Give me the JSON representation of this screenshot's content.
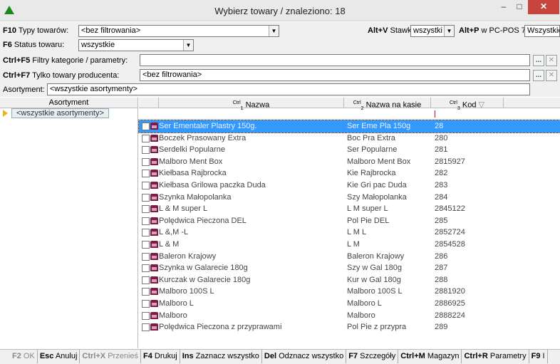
{
  "window": {
    "title": "Wybierz towary / znaleziono: 18",
    "minimize": "–",
    "maximize": "□",
    "close": "✕"
  },
  "filters": {
    "typy_key": "F10",
    "typy_label": "Typy towarów:",
    "typy_value": "<bez filtrowania>",
    "status_key": "F6",
    "status_label": "Status towaru:",
    "status_value": "wszystkie",
    "stawka_key": "Alt+V",
    "stawka_label": "Stawka:",
    "stawka_value": "wszystki",
    "pcpos_key": "Alt+P",
    "pcpos_label": "w PC-POS 7:",
    "pcpos_value": "Wszystkie",
    "kategorie_key": "Ctrl+F5",
    "kategorie_label": "Filtry kategorie / parametry:",
    "kategorie_value": "",
    "producent_key": "Ctrl+F7",
    "producent_label": "Tylko towary producenta:",
    "producent_value": "<bez filtrowania>",
    "asortyment_label": "Asortyment:",
    "asortyment_value": "<wszystkie asortymenty>",
    "dots": "...",
    "clear": "✕"
  },
  "left_pane": {
    "header": "Asortyment",
    "items": [
      "<wszystkie asortymenty>"
    ]
  },
  "grid": {
    "columns": [
      {
        "ctrl": "Ctrl",
        "num": "1",
        "label": "Nazwa"
      },
      {
        "ctrl": "Ctrl",
        "num": "2",
        "label": "Nazwa na kasie"
      },
      {
        "ctrl": "Ctrl",
        "num": "3",
        "label": "Kod",
        "sort": "▽"
      }
    ],
    "rows": [
      {
        "name": "Ser Ementaler Plastry 150g.",
        "kasa": "Ser Eme Pla 150g",
        "kod": "28",
        "selected": true
      },
      {
        "name": "Boczek Prasowany Extra",
        "kasa": "Boc Pra Extra",
        "kod": "280"
      },
      {
        "name": "Serdelki Popularne",
        "kasa": "Ser Popularne",
        "kod": "281"
      },
      {
        "name": "Malboro Ment Box",
        "kasa": "Malboro Ment Box",
        "kod": "2815927"
      },
      {
        "name": "Kiełbasa Rajbrocka",
        "kasa": "Kie Rajbrocka",
        "kod": "282"
      },
      {
        "name": "Kiełbasa Grilowa paczka Duda",
        "kasa": "Kie Gri pac Duda",
        "kod": "283"
      },
      {
        "name": "Szynka Małopolanka",
        "kasa": "Szy Małopolanka",
        "kod": "284"
      },
      {
        "name": "L & M super L",
        "kasa": "L M super L",
        "kod": "2845122"
      },
      {
        "name": "Polędwica Pieczona DEL",
        "kasa": "Pol Pie DEL",
        "kod": "285"
      },
      {
        "name": "L &,M -L",
        "kasa": "L M L",
        "kod": "2852724"
      },
      {
        "name": "L & M",
        "kasa": "L M",
        "kod": "2854528"
      },
      {
        "name": "Baleron Krajowy",
        "kasa": "Baleron Krajowy",
        "kod": "286"
      },
      {
        "name": "Szynka w Galarecie 180g",
        "kasa": "Szy w Gal 180g",
        "kod": "287"
      },
      {
        "name": "Kurczak w Galarecie 180g",
        "kasa": "Kur w Gal 180g",
        "kod": "288"
      },
      {
        "name": "Malboro 100S L",
        "kasa": "Malboro 100S L",
        "kod": "2881920"
      },
      {
        "name": "Malboro L",
        "kasa": "Malboro L",
        "kod": "2886925"
      },
      {
        "name": "Malboro",
        "kasa": "Malboro",
        "kod": "2888224"
      },
      {
        "name": "Polędwica Pieczona z przyprawami",
        "kasa": "Pol Pie z przypra",
        "kod": "289"
      }
    ]
  },
  "statusbar": [
    {
      "key": "F2",
      "label": "OK",
      "disabled": true
    },
    {
      "key": "Esc",
      "label": "Anuluj"
    },
    {
      "key": "Ctrl+X",
      "label": "Przenieś",
      "disabled": true
    },
    {
      "key": "F4",
      "label": "Drukuj"
    },
    {
      "key": "Ins",
      "label": "Zaznacz wszystko"
    },
    {
      "key": "Del",
      "label": "Odznacz wszystko"
    },
    {
      "key": "F7",
      "label": "Szczegóły"
    },
    {
      "key": "Ctrl+M",
      "label": "Magazyn"
    },
    {
      "key": "Ctrl+R",
      "label": "Parametry"
    },
    {
      "key": "F9",
      "label": "I"
    }
  ]
}
